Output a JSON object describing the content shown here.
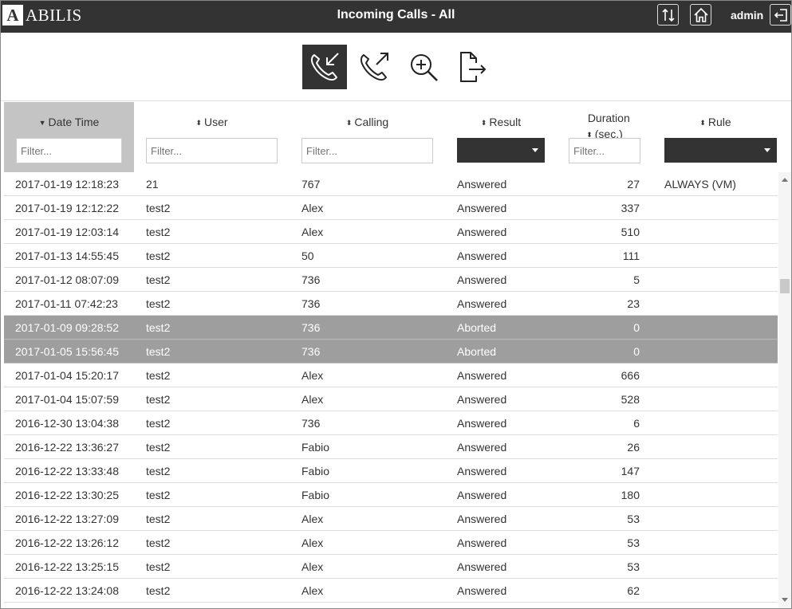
{
  "app": {
    "logo_letter": "A",
    "logo_text": "ABILIS",
    "title": "Incoming Calls - All",
    "user": "admin"
  },
  "icons": {
    "sort_toggle": "sort-arrows-icon",
    "home": "home-icon",
    "logout": "logout-icon",
    "incoming": "incoming-call-icon",
    "outgoing": "outgoing-call-icon",
    "zoom": "zoom-in-icon",
    "export": "export-file-icon"
  },
  "columns": {
    "date": {
      "label": "Date Time",
      "filter_placeholder": "Filter..."
    },
    "user": {
      "label": "User",
      "filter_placeholder": "Filter..."
    },
    "calling": {
      "label": "Calling",
      "filter_placeholder": "Filter..."
    },
    "result": {
      "label": "Result",
      "filter_value": ""
    },
    "duration": {
      "label_line1": "Duration",
      "label_line2": "(sec.)",
      "filter_placeholder": "Filter..."
    },
    "rule": {
      "label": "Rule",
      "filter_value": ""
    }
  },
  "colors": {
    "topbar": "#333333",
    "selected_row": "#9e9e9e",
    "sorted_header": "#c4c4c4"
  },
  "rows": [
    {
      "date": "2017-01-19 12:18:23",
      "user": "21",
      "calling": "767",
      "result": "Answered",
      "duration": "27",
      "rule": "ALWAYS (VM)",
      "selected": false
    },
    {
      "date": "2017-01-19 12:12:22",
      "user": "test2",
      "calling": "Alex",
      "result": "Answered",
      "duration": "337",
      "rule": "",
      "selected": false
    },
    {
      "date": "2017-01-19 12:03:14",
      "user": "test2",
      "calling": "Alex",
      "result": "Answered",
      "duration": "510",
      "rule": "",
      "selected": false
    },
    {
      "date": "2017-01-13 14:55:45",
      "user": "test2",
      "calling": "50",
      "result": "Answered",
      "duration": "111",
      "rule": "",
      "selected": false
    },
    {
      "date": "2017-01-12 08:07:09",
      "user": "test2",
      "calling": "736",
      "result": "Answered",
      "duration": "5",
      "rule": "",
      "selected": false
    },
    {
      "date": "2017-01-11 07:42:23",
      "user": "test2",
      "calling": "736",
      "result": "Answered",
      "duration": "23",
      "rule": "",
      "selected": false
    },
    {
      "date": "2017-01-09 09:28:52",
      "user": "test2",
      "calling": "736",
      "result": "Aborted",
      "duration": "0",
      "rule": "",
      "selected": true
    },
    {
      "date": "2017-01-05 15:56:45",
      "user": "test2",
      "calling": "736",
      "result": "Aborted",
      "duration": "0",
      "rule": "",
      "selected": true
    },
    {
      "date": "2017-01-04 15:20:17",
      "user": "test2",
      "calling": "Alex",
      "result": "Answered",
      "duration": "666",
      "rule": "",
      "selected": false
    },
    {
      "date": "2017-01-04 15:07:59",
      "user": "test2",
      "calling": "Alex",
      "result": "Answered",
      "duration": "528",
      "rule": "",
      "selected": false
    },
    {
      "date": "2016-12-30 13:04:38",
      "user": "test2",
      "calling": "736",
      "result": "Answered",
      "duration": "6",
      "rule": "",
      "selected": false
    },
    {
      "date": "2016-12-22 13:36:27",
      "user": "test2",
      "calling": "Fabio",
      "result": "Answered",
      "duration": "26",
      "rule": "",
      "selected": false
    },
    {
      "date": "2016-12-22 13:33:48",
      "user": "test2",
      "calling": "Fabio",
      "result": "Answered",
      "duration": "147",
      "rule": "",
      "selected": false
    },
    {
      "date": "2016-12-22 13:30:25",
      "user": "test2",
      "calling": "Fabio",
      "result": "Answered",
      "duration": "180",
      "rule": "",
      "selected": false
    },
    {
      "date": "2016-12-22 13:27:09",
      "user": "test2",
      "calling": "Alex",
      "result": "Answered",
      "duration": "53",
      "rule": "",
      "selected": false
    },
    {
      "date": "2016-12-22 13:26:12",
      "user": "test2",
      "calling": "Alex",
      "result": "Answered",
      "duration": "53",
      "rule": "",
      "selected": false
    },
    {
      "date": "2016-12-22 13:25:15",
      "user": "test2",
      "calling": "Alex",
      "result": "Answered",
      "duration": "53",
      "rule": "",
      "selected": false
    },
    {
      "date": "2016-12-22 13:24:08",
      "user": "test2",
      "calling": "Alex",
      "result": "Answered",
      "duration": "62",
      "rule": "",
      "selected": false
    }
  ]
}
